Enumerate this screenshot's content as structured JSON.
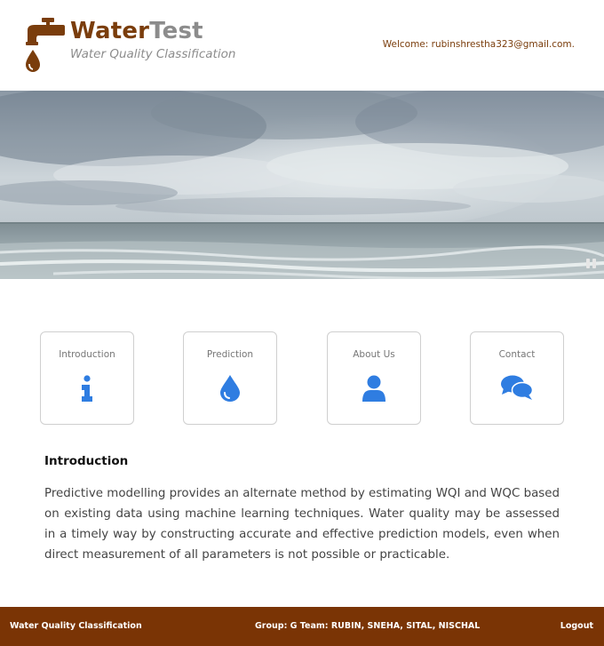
{
  "header": {
    "brand_part1": "Water",
    "brand_part2": "Test",
    "tagline": "Water Quality Classification",
    "welcome": "Welcome: rubinshrestha323@gmail.com."
  },
  "nav_cards": [
    {
      "label": "Introduction",
      "icon": "info-icon"
    },
    {
      "label": "Prediction",
      "icon": "water-drop-icon"
    },
    {
      "label": "About Us",
      "icon": "user-icon"
    },
    {
      "label": "Contact",
      "icon": "chat-icon"
    }
  ],
  "content": {
    "title": "Introduction",
    "body": "Predictive modelling provides an alternate method by estimating WQI and WQC based on existing data using machine learning techniques. Water quality may be assessed in a timely way by constructing accurate and effective prediction models, even when direct measurement of all parameters is not possible or practicable."
  },
  "footer": {
    "left": "Water Quality Classification",
    "center": "Group: G Team: RUBIN, SNEHA, SITAL, NISCHAL",
    "right": "Logout"
  },
  "colors": {
    "brand_brown": "#7a3d0c",
    "footer_brown": "#7a3405",
    "icon_blue": "#2f7de1",
    "gray_text": "#8c8c8c"
  }
}
